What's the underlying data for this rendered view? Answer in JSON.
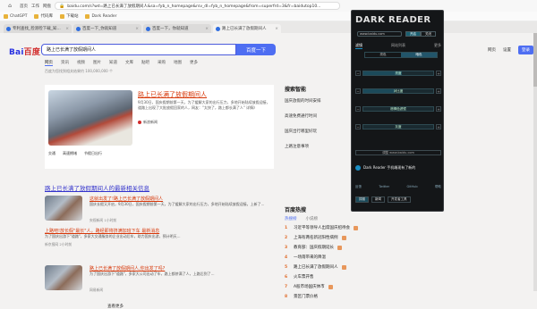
{
  "browser": {
    "nav": [
      "首页",
      "工作",
      "网盘"
    ],
    "url": "baidu.com/s?wd=路上已长满了放假期间人&sa=fyb_n_homepage&rsv_dl=fyb_n_homepage&from=superfrd=3&fr=baidutop10..."
  },
  "bookmarks": [
    "ChatGPT",
    "代码库",
    "下载站",
    "Dark Reader"
  ],
  "tabs": [
    {
      "label": "专利查找_检测检下载_知..."
    },
    {
      "label": "百度一下_你就知道"
    },
    {
      "label": "百度一下，你就知道"
    },
    {
      "label": "路上已长满了放假期间人"
    }
  ],
  "search": {
    "logo_left": "Bai",
    "logo_right": "百度",
    "query": "路上已长满了放假期间人",
    "button": "百度一下",
    "right": [
      "网页",
      "设置",
      "登录"
    ]
  },
  "filters": [
    "网页",
    "资讯",
    "视频",
    "图片",
    "知道",
    "文库",
    "贴吧",
    "采购",
    "地图",
    "更多"
  ],
  "meta": "百度为您找到相关结果约 100,000,000 个",
  "result1": {
    "title": "路上已长满了放假期间人",
    "desc": "9月30日，国庆假期前第一天，为了缓解大家的出行压力，多地开始陆续放假迎接，道路上出现了大批放假回家的人，网友：\"太快了，路上都长满了人\" 详情》",
    "source": "新浪新闻",
    "related": [
      "交通",
      "高速拥堵",
      "节假日出行"
    ]
  },
  "news_heading": "路上已长满了放假期间人的最新相关信息",
  "news": [
    {
      "title": "这就出发了!路上已长满了放假期间人",
      "desc": "国庆长假又开启，9月30日，国庆假期前第一天，为了缓解大家的出行压力，多地开始陆续放假迎接。上新了...",
      "source": "央视新闻  1小时前"
    },
    {
      "title": "上路吧!放长假\"最长\"人，路经即将挤满加班下车 最新消息",
      "desc": "为了国庆出游下\"道路\"，多家大交通服务的企业出动后车，助力国庆出游，预计明天...",
      "source": "新京报网  2小时前"
    },
    {
      "title": "路上已长满了放假期间人,你出发了吗?",
      "desc": "为了国庆出游下\"道路\"，多家大公司出动了车，路上都挤满了人，上路后到了...",
      "source": "网易新闻"
    }
  ],
  "more": "查看更多",
  "side_title": "搜索智能",
  "side_qs": [
    "国庆放假的时间安排",
    "高速免费通行时间",
    "国庆出行哪里好玩",
    "上路注意事项"
  ],
  "hot_title": "百度热搜",
  "hot_tabs": [
    "热搜榜",
    "小说榜"
  ],
  "hot": [
    {
      "n": "1",
      "text": "习近平等领导人出席国庆招待会"
    },
    {
      "n": "2",
      "text": "上海有两名新冠阳性病例"
    },
    {
      "n": "3",
      "text": "教育部：国庆假期延长"
    },
    {
      "n": "4",
      "text": "一场雨带来的降温"
    },
    {
      "n": "5",
      "text": "路上已长满了放假期间人"
    },
    {
      "n": "6",
      "text": "火车票开售"
    },
    {
      "n": "7",
      "text": "A股市场国庆休市"
    },
    {
      "n": "8",
      "text": "景区门票价格"
    }
  ],
  "darkreader": {
    "brand": "DARK READER",
    "site": "www.baidu.com",
    "on": "开启",
    "off": "关闭",
    "tabs": [
      "滤镜",
      "网站列表",
      "更多"
    ],
    "modes": [
      "亮色",
      "暗色"
    ],
    "sliders": [
      {
        "label": "亮度",
        "level": 0.55
      },
      {
        "label": "对比度",
        "level": 0.45
      },
      {
        "label": "棕褐色滤镜",
        "level": 0.0
      },
      {
        "label": "灰度",
        "level": 0.0
      }
    ],
    "dim": "调整 www.baidu.com",
    "notice": "Dark Reader 手机端现有了新的",
    "links": [
      "反馈",
      "Twitter",
      "GitHub",
      "帮助"
    ],
    "bottom": [
      "捐赠",
      "新闻",
      "开发者工具"
    ]
  }
}
